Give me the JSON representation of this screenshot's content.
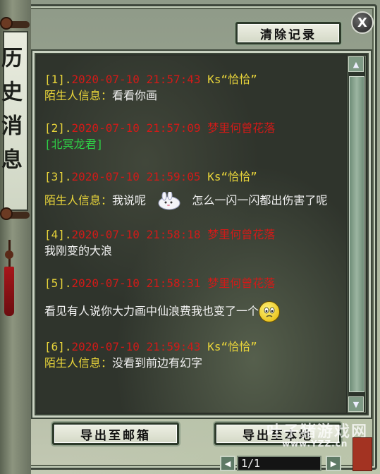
{
  "window": {
    "banner_title": "历史消息",
    "close_label": "X"
  },
  "toolbar": {
    "clear_label": "清除记录",
    "export_mail_label": "导出至邮箱",
    "export_local_label": "导出至本地"
  },
  "messages": [
    {
      "index": "[1].",
      "time": "2020-07-10 21:57:43",
      "sender": "Ks“恰恰”",
      "sender_color": "yellow",
      "label": "陌生人信息：",
      "text": "看看你画"
    },
    {
      "index": "[2].",
      "time": "2020-07-10 21:57:09",
      "sender": "梦里何曾花落",
      "sender_color": "red",
      "label": "",
      "text": "[北冥龙君]",
      "text_color": "green"
    },
    {
      "index": "[3].",
      "time": "2020-07-10 21:59:05",
      "sender": "Ks“恰恰”",
      "sender_color": "yellow",
      "label": "陌生人信息：",
      "text": "我说呢",
      "emoji": "bunny-emoji",
      "text_after": "怎么一闪一闪都出伤害了呢"
    },
    {
      "index": "[4].",
      "time": "2020-07-10 21:58:18",
      "sender": "梦里何曾花落",
      "sender_color": "red",
      "label": "",
      "text": "我刚变的大浪"
    },
    {
      "index": "[5].",
      "time": "2020-07-10 21:58:31",
      "sender": "梦里何曾花落",
      "sender_color": "red",
      "label": "",
      "text": "看见有人说你大力画中仙浪费我也变了一个",
      "emoji": "sad-face-emoji"
    },
    {
      "index": "[6].",
      "time": "2020-07-10 21:59:43",
      "sender": "Ks“恰恰”",
      "sender_color": "yellow",
      "label": "陌生人信息：",
      "text": "没看到前边有幻字"
    }
  ],
  "pager": {
    "page_text": "1/1",
    "prev_icon": "first-page-icon",
    "next_icon": "last-page-icon"
  },
  "watermark": {
    "brand": "叶子猪游戏网",
    "url": "www.YZZ.cn"
  },
  "colors": {
    "time_red": "#d21a18",
    "name_yellow": "#e8d43a",
    "text_white": "#f2f2f2",
    "text_green": "#2ed046"
  }
}
